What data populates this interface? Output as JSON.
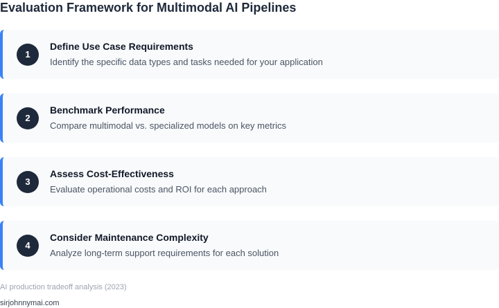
{
  "title": "Evaluation Framework for Multimodal AI Pipelines",
  "steps": [
    {
      "number": "1",
      "title": "Define Use Case Requirements",
      "description": "Identify the specific data types and tasks needed for your application"
    },
    {
      "number": "2",
      "title": "Benchmark Performance",
      "description": "Compare multimodal vs. specialized models on key metrics"
    },
    {
      "number": "3",
      "title": "Assess Cost-Effectiveness",
      "description": "Evaluate operational costs and ROI for each approach"
    },
    {
      "number": "4",
      "title": "Consider Maintenance Complexity",
      "description": "Analyze long-term support requirements for each solution"
    }
  ],
  "footer": {
    "source": "AI production tradeoff analysis (2023)",
    "site": "sirjohnnymai.com"
  },
  "colors": {
    "accent": "#3b82f6",
    "badge": "#1e293b",
    "card_background": "#f8fafc"
  }
}
